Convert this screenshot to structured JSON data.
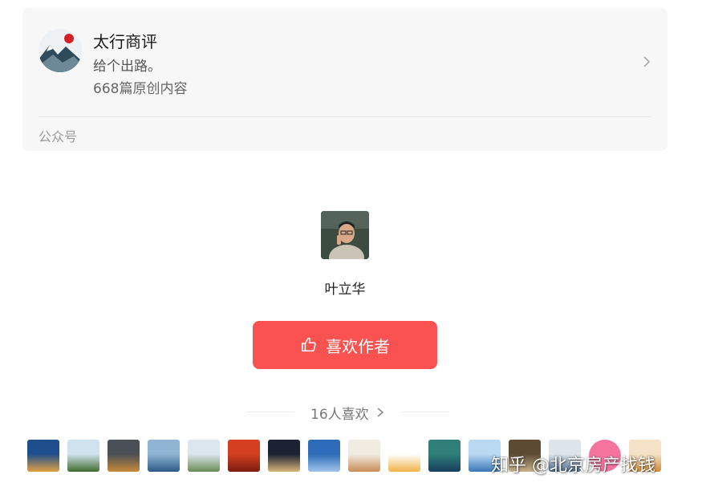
{
  "account": {
    "name": "太行商评",
    "description": "给个出路。",
    "article_count": "668篇原创内容",
    "type": "公众号"
  },
  "author": {
    "name": "叶立华"
  },
  "like_button": {
    "label": "喜欢作者",
    "color": "#fa5151"
  },
  "likes": {
    "count_text": "16人喜欢"
  },
  "likers": [
    {
      "avatar_colors": [
        "#1e4f8c",
        "#e0a040"
      ]
    },
    {
      "avatar_colors": [
        "#cfe3ee",
        "#3f6b2e"
      ]
    },
    {
      "avatar_colors": [
        "#4a5055",
        "#c98a3c"
      ]
    },
    {
      "avatar_colors": [
        "#8fb4d4",
        "#2d5a86"
      ]
    },
    {
      "avatar_colors": [
        "#dbe6ee",
        "#6a8b55"
      ]
    },
    {
      "avatar_colors": [
        "#d4401f",
        "#7a1a10"
      ]
    },
    {
      "avatar_colors": [
        "#1c2233",
        "#d9b57a"
      ]
    },
    {
      "avatar_colors": [
        "#2e6bb8",
        "#9fc4ea"
      ]
    },
    {
      "avatar_colors": [
        "#f0ece2",
        "#c98c55"
      ]
    },
    {
      "avatar_colors": [
        "#ffffff",
        "#f1b24a"
      ]
    },
    {
      "avatar_colors": [
        "#2f7f78",
        "#163e5e"
      ]
    },
    {
      "avatar_colors": [
        "#b9d8f2",
        "#3a76b6"
      ]
    },
    {
      "avatar_colors": [
        "#5d4a32",
        "#c9b28a"
      ]
    },
    {
      "avatar_colors": [
        "#dde4ea",
        "#4c6a8a"
      ]
    },
    {
      "avatar_colors": [
        "#f4749e",
        "#ffffff"
      ]
    },
    {
      "avatar_colors": [
        "#f5e2c6",
        "#d08a3a"
      ]
    }
  ],
  "watermark": "知乎 @北京房产找钱"
}
